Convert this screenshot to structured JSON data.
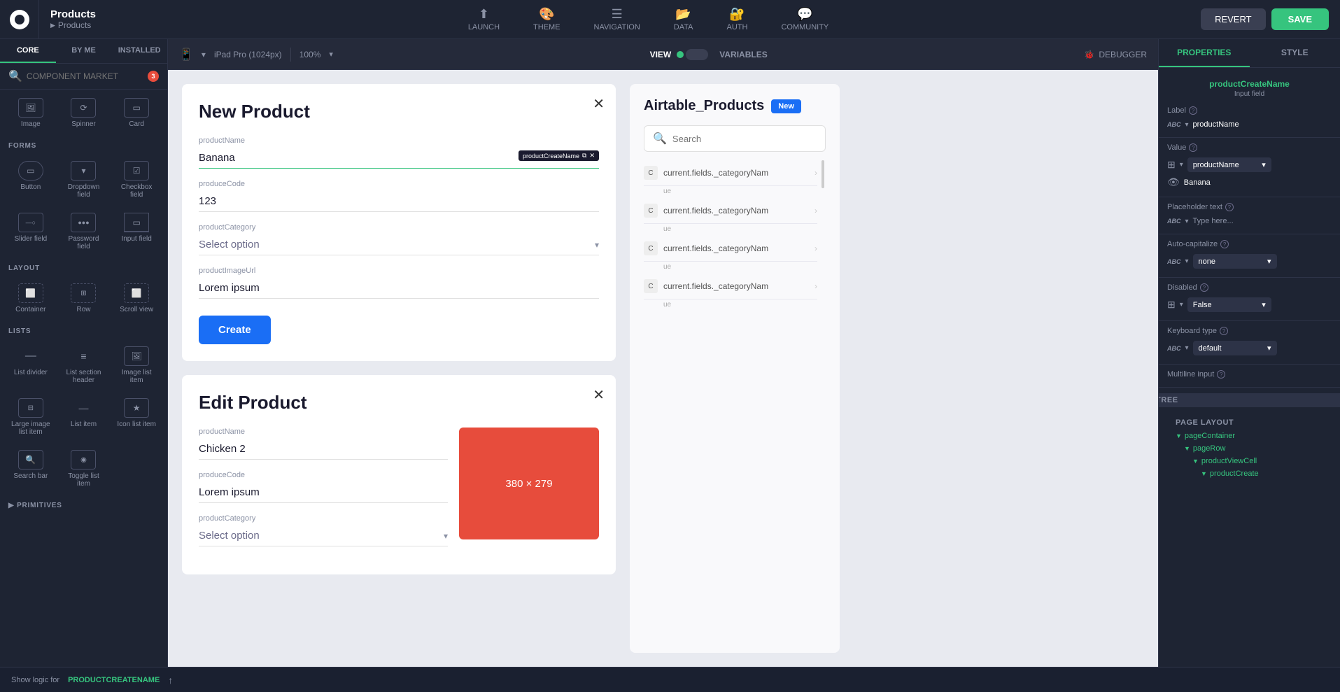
{
  "app": {
    "title": "Products",
    "subtitle": "Products"
  },
  "topnav": {
    "launch": "LAUNCH",
    "theme": "THEME",
    "navigation": "NAVIGATION",
    "data": "DATA",
    "auth": "AUTH",
    "community": "COMMUNITY",
    "revert": "REVERT",
    "save": "SAVE"
  },
  "sidebar": {
    "tabs": [
      "CORE",
      "BY ME",
      "INSTALLED"
    ],
    "active_tab": "CORE",
    "search_placeholder": "COMPONENT MARKET",
    "badge": "3",
    "sections": {
      "forms": "FORMS",
      "layout": "LAYOUT",
      "lists": "LISTS",
      "primitives": "PRIMITIVES"
    },
    "components_top": [
      {
        "icon": "🖼",
        "label": "Image"
      },
      {
        "icon": "⟳",
        "label": "Spinner"
      },
      {
        "icon": "▭",
        "label": "Card"
      }
    ],
    "components_forms": [
      {
        "icon": "▭",
        "label": "Button"
      },
      {
        "icon": "▾",
        "label": "Dropdown field"
      },
      {
        "icon": "☑",
        "label": "Checkbox field"
      },
      {
        "icon": "—○",
        "label": "Slider field"
      },
      {
        "icon": "●●●",
        "label": "Password field"
      },
      {
        "icon": "▭",
        "label": "Input field"
      }
    ],
    "components_layout": [
      {
        "icon": "⬜",
        "label": "Container"
      },
      {
        "icon": "⊞",
        "label": "Row"
      },
      {
        "icon": "⬜",
        "label": "Scroll view"
      }
    ],
    "components_lists": [
      {
        "icon": "—",
        "label": "List divider"
      },
      {
        "icon": "≡",
        "label": "List section header"
      },
      {
        "icon": "🖼",
        "label": "Image list item"
      },
      {
        "icon": "⊟",
        "label": "Large image list item"
      },
      {
        "icon": "—",
        "label": "List item"
      },
      {
        "icon": "★",
        "label": "Icon list item"
      },
      {
        "icon": "🔍",
        "label": "Search bar"
      },
      {
        "icon": "◉",
        "label": "Toggle list item"
      }
    ]
  },
  "sub_toolbar": {
    "device": "iPad Pro (1024px)",
    "zoom": "100%",
    "view": "VIEW",
    "variables": "VARIABLES",
    "debugger": "DEBUGGER"
  },
  "new_product_form": {
    "title": "New Product",
    "fields": [
      {
        "label": "productName",
        "value": "Banana",
        "active": true,
        "tag": "productCreateName"
      },
      {
        "label": "produceCode",
        "value": "123"
      },
      {
        "label": "productCategory",
        "value": "Select option",
        "type": "select"
      },
      {
        "label": "productImageUrl",
        "value": "Lorem ipsum"
      }
    ],
    "create_btn": "Create"
  },
  "edit_product_form": {
    "title": "Edit Product",
    "fields": [
      {
        "label": "productName",
        "value": "Chicken 2"
      },
      {
        "label": "produceCode",
        "value": "Lorem ipsum"
      },
      {
        "label": "productCategory",
        "value": "Select option",
        "type": "select"
      }
    ],
    "image_placeholder": "380 × 279",
    "image_color": "#e74c3c"
  },
  "airtable": {
    "title": "Airtable_Products",
    "badge": "New",
    "search_placeholder": "Search",
    "rows": [
      {
        "text": "current.fields._categoryNam"
      },
      {
        "text": "current.fields._categoryNam"
      },
      {
        "text": "current.fields._categoryNam"
      },
      {
        "text": "current.fields._categoryNam"
      }
    ]
  },
  "properties_panel": {
    "tabs": [
      "PROPERTIES",
      "STYLE"
    ],
    "active_tab": "PROPERTIES",
    "component_name": "productCreateName",
    "component_type": "Input field",
    "label": {
      "title": "Label",
      "value": "productName"
    },
    "value": {
      "title": "Value",
      "binding": "productName",
      "display": "Banana"
    },
    "placeholder": {
      "title": "Placeholder text",
      "value": "Type here..."
    },
    "auto_capitalize": {
      "title": "Auto-capitalize",
      "value": "none"
    },
    "disabled": {
      "title": "Disabled",
      "value": "False"
    },
    "keyboard_type": {
      "title": "Keyboard type",
      "value": "default"
    },
    "multiline": {
      "title": "Multiline input"
    },
    "tree": {
      "header": "TREE",
      "page_layout": "PAGE LAYOUT",
      "items": [
        {
          "label": "pageContainer",
          "level": 0,
          "color": "teal",
          "arrow": "▼"
        },
        {
          "label": "pageRow",
          "level": 1,
          "color": "teal",
          "arrow": "▼"
        },
        {
          "label": "productViewCell",
          "level": 2,
          "color": "teal",
          "arrow": "▼"
        },
        {
          "label": "productCreate",
          "level": 3,
          "color": "teal",
          "arrow": "▼"
        }
      ]
    }
  },
  "bottom_bar": {
    "show_logic_for": "Show logic for",
    "component": "PRODUCTCREATENAME",
    "icon": "↑"
  }
}
